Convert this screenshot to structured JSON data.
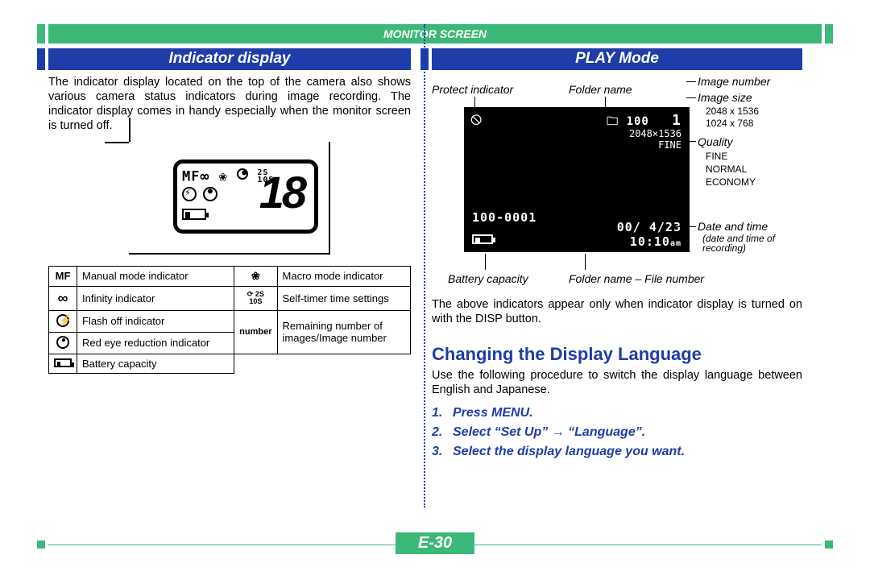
{
  "header_title": "MONITOR SCREEN",
  "left": {
    "heading": "Indicator display",
    "para": "The indicator display located on the top of the camera also shows various camera status indicators during image recording. The indicator display comes in handy especially when the monitor screen is turned off.",
    "lcd": {
      "row1_mf": "MF",
      "row1_inf": "∞",
      "row1_flower": "❀",
      "row1_timer1": "2S",
      "row1_timer2": "10S",
      "big_number": "18"
    },
    "table": {
      "r1c1": "MF",
      "r1c2": "Manual mode indicator",
      "r1c3_icon": "flower",
      "r1c4": "Macro mode indicator",
      "r2c1": "∞",
      "r2c2": "Infinity indicator",
      "r2c3_icon": "timer",
      "r2c4": "Self-timer time settings",
      "r3c1_icon": "flash",
      "r3c2": "Flash off indicator",
      "r3c3": "number",
      "r3c4a": "Remaining number of",
      "r3c4b": "images/Image number",
      "r4c1_icon": "eye",
      "r4c2": "Red eye reduction indicator",
      "r5c1_icon": "batt",
      "r5c2": "Battery capacity"
    }
  },
  "right": {
    "heading": "PLAY Mode",
    "labels": {
      "protect": "Protect indicator",
      "folder": "Folder name",
      "image_number": "Image number",
      "image_size": "Image size",
      "size1": "2048 x 1536",
      "size2": "1024 x 768",
      "quality": "Quality",
      "q1": "FINE",
      "q2": "NORMAL",
      "q3": "ECONOMY",
      "date_time": "Date and time",
      "date_time_note": "(date and time of recording)",
      "battery": "Battery capacity",
      "folder_file": "Folder name – File number"
    },
    "screen": {
      "folder_num": "100",
      "img_num": "1",
      "size": "2048×1536",
      "qual": "FINE",
      "folder_file": "100-0001",
      "date": "00/ 4/23",
      "time": "10:10",
      "ampm": "am"
    },
    "para2": "The above indicators appear only when indicator display is turned on with the DISP button.",
    "sub_heading": "Changing the Display Language",
    "para3": "Use the following procedure to switch the display language between English and Japanese.",
    "steps": {
      "s1": "Press MENU.",
      "s2": "Select “Set Up” → “Language”.",
      "s3": "Select the display language you want."
    }
  },
  "page_number": "E-30"
}
